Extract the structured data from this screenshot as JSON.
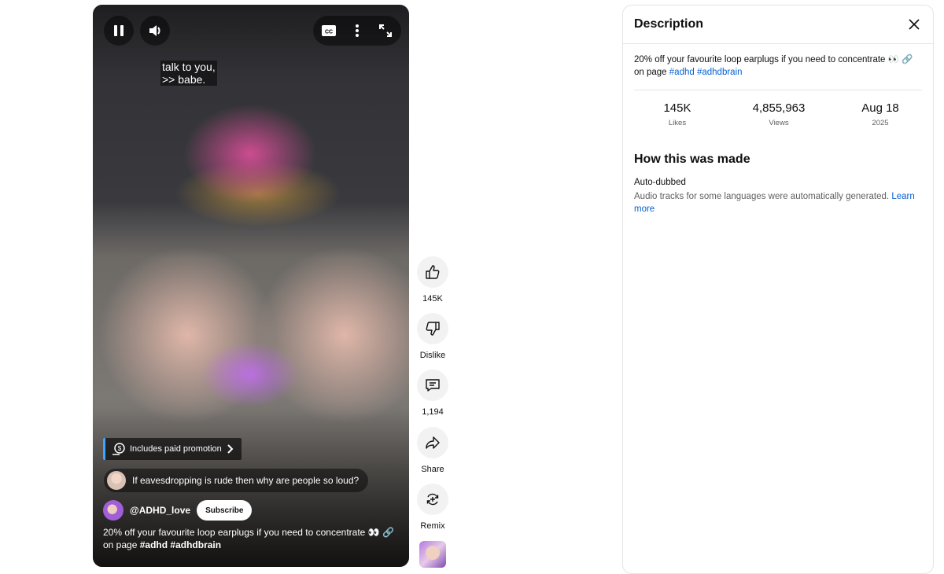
{
  "player": {
    "caption_lines": [
      "talk to you,",
      ">> babe."
    ],
    "cc_label": "CC",
    "paid_promotion": "Includes paid promotion",
    "comment": "If eavesdropping is rude then why are people so loud?",
    "channel_name": "@ADHD_love",
    "subscribe_label": "Subscribe",
    "description_text": "20% off your favourite loop earplugs if you need to concentrate 👀 🔗 on page",
    "description_tags": "#adhd #adhdbrain"
  },
  "actions": [
    {
      "icon": "thumbs-up-icon",
      "label": "145K"
    },
    {
      "icon": "thumbs-down-icon",
      "label": "Dislike"
    },
    {
      "icon": "comment-icon",
      "label": "1,194"
    },
    {
      "icon": "share-icon",
      "label": "Share"
    },
    {
      "icon": "remix-icon",
      "label": "Remix"
    }
  ],
  "panel": {
    "title": "Description",
    "description_text": "20% off your favourite loop earplugs if you need to concentrate 👀 🔗 on page",
    "tags": [
      "#adhd",
      "#adhdbrain"
    ],
    "stats": [
      {
        "value": "145K",
        "label": "Likes"
      },
      {
        "value": "4,855,963",
        "label": "Views"
      },
      {
        "value": "Aug 18",
        "label": "2025"
      }
    ],
    "how_title": "How this was made",
    "auto_dubbed_title": "Auto-dubbed",
    "auto_dubbed_text": "Audio tracks for some languages were automatically generated.",
    "learn_more": "Learn more"
  },
  "colors": {
    "link": "#065fd4",
    "paid_accent": "#3ea6ff"
  }
}
